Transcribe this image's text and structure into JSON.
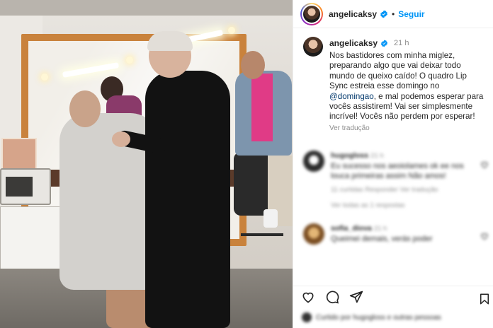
{
  "post": {
    "username": "angelicaksy",
    "follow_label": "Seguir",
    "separator": "•"
  },
  "caption": {
    "username": "angelicaksy",
    "time": "21 h",
    "text_part1": "Nos bastidores com minha miglez, preparando algo que vai deixar todo mundo de queixo caído! O quadro Lip Sync estreia esse domingo no ",
    "mention": "@domingao",
    "text_part2": ", e mal podemos esperar para vocês assistirem! Vai ser simplesmente incrível! Vocês não perdem por esperar!",
    "translate_label": "Ver tradução"
  },
  "comments": [
    {
      "name": "hugogloss",
      "time": "21 h",
      "text": "Eu sucesso nos aeoiolames ok ee nos louca primeiras assim Não amos!",
      "meta": "11 curtidas   Responder   Ver tradução",
      "replies": "Ver todas as 1 respostas"
    },
    {
      "name": "sofia_diova",
      "time": "21 h",
      "text": "Queimei demais, verás poder",
      "meta": ""
    }
  ],
  "footer": {
    "liked_by": "Curtido por hugogloss e outras pessoas"
  },
  "colors": {
    "accent": "#0095f6",
    "mention": "#00376b",
    "muted": "#8e8e8e"
  },
  "icons": {
    "verified": "verified-badge-icon",
    "like": "heart-icon",
    "comment": "comment-icon",
    "share": "share-icon",
    "save": "bookmark-icon"
  }
}
